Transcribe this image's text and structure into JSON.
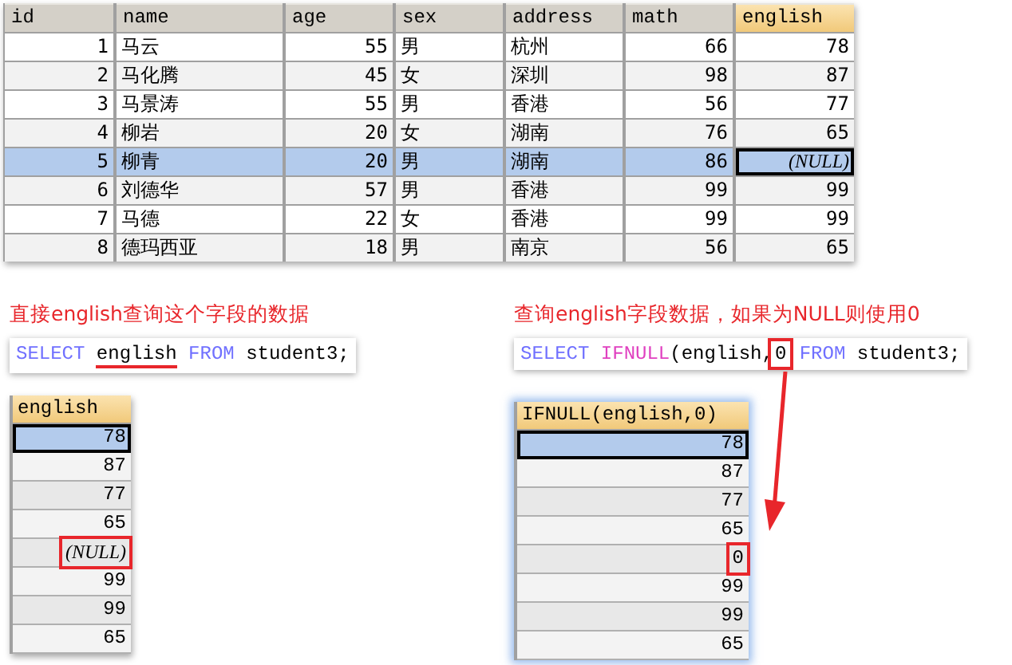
{
  "table": {
    "columns": [
      {
        "label": "id",
        "numeric": true,
        "selected": false
      },
      {
        "label": "name",
        "numeric": false,
        "selected": false
      },
      {
        "label": "age",
        "numeric": true,
        "selected": false
      },
      {
        "label": "sex",
        "numeric": false,
        "selected": false
      },
      {
        "label": "address",
        "numeric": false,
        "selected": false
      },
      {
        "label": "math",
        "numeric": true,
        "selected": false
      },
      {
        "label": "english",
        "numeric": true,
        "selected": true
      }
    ],
    "rows": [
      {
        "selected": false,
        "cells": [
          {
            "text": "1",
            "focused": false,
            "null": false
          },
          {
            "text": "马云",
            "focused": false,
            "null": false
          },
          {
            "text": "55",
            "focused": false,
            "null": false
          },
          {
            "text": "男",
            "focused": false,
            "null": false
          },
          {
            "text": "杭州",
            "focused": false,
            "null": false
          },
          {
            "text": "66",
            "focused": false,
            "null": false
          },
          {
            "text": "78",
            "focused": false,
            "null": false
          }
        ]
      },
      {
        "selected": false,
        "cells": [
          {
            "text": "2",
            "focused": false,
            "null": false
          },
          {
            "text": "马化腾",
            "focused": false,
            "null": false
          },
          {
            "text": "45",
            "focused": false,
            "null": false
          },
          {
            "text": "女",
            "focused": false,
            "null": false
          },
          {
            "text": "深圳",
            "focused": false,
            "null": false
          },
          {
            "text": "98",
            "focused": false,
            "null": false
          },
          {
            "text": "87",
            "focused": false,
            "null": false
          }
        ]
      },
      {
        "selected": false,
        "cells": [
          {
            "text": "3",
            "focused": false,
            "null": false
          },
          {
            "text": "马景涛",
            "focused": false,
            "null": false
          },
          {
            "text": "55",
            "focused": false,
            "null": false
          },
          {
            "text": "男",
            "focused": false,
            "null": false
          },
          {
            "text": "香港",
            "focused": false,
            "null": false
          },
          {
            "text": "56",
            "focused": false,
            "null": false
          },
          {
            "text": "77",
            "focused": false,
            "null": false
          }
        ]
      },
      {
        "selected": false,
        "cells": [
          {
            "text": "4",
            "focused": false,
            "null": false
          },
          {
            "text": "柳岩",
            "focused": false,
            "null": false
          },
          {
            "text": "20",
            "focused": false,
            "null": false
          },
          {
            "text": "女",
            "focused": false,
            "null": false
          },
          {
            "text": "湖南",
            "focused": false,
            "null": false
          },
          {
            "text": "76",
            "focused": false,
            "null": false
          },
          {
            "text": "65",
            "focused": false,
            "null": false
          }
        ]
      },
      {
        "selected": true,
        "cells": [
          {
            "text": "5",
            "focused": false,
            "null": false
          },
          {
            "text": "柳青",
            "focused": false,
            "null": false
          },
          {
            "text": "20",
            "focused": false,
            "null": false
          },
          {
            "text": "男",
            "focused": false,
            "null": false
          },
          {
            "text": "湖南",
            "focused": false,
            "null": false
          },
          {
            "text": "86",
            "focused": false,
            "null": false
          },
          {
            "text": "(NULL)",
            "focused": true,
            "null": true
          }
        ]
      },
      {
        "selected": false,
        "cells": [
          {
            "text": "6",
            "focused": false,
            "null": false
          },
          {
            "text": "刘德华",
            "focused": false,
            "null": false
          },
          {
            "text": "57",
            "focused": false,
            "null": false
          },
          {
            "text": "男",
            "focused": false,
            "null": false
          },
          {
            "text": "香港",
            "focused": false,
            "null": false
          },
          {
            "text": "99",
            "focused": false,
            "null": false
          },
          {
            "text": "99",
            "focused": false,
            "null": false
          }
        ]
      },
      {
        "selected": false,
        "cells": [
          {
            "text": "7",
            "focused": false,
            "null": false
          },
          {
            "text": "马德",
            "focused": false,
            "null": false
          },
          {
            "text": "22",
            "focused": false,
            "null": false
          },
          {
            "text": "女",
            "focused": false,
            "null": false
          },
          {
            "text": "香港",
            "focused": false,
            "null": false
          },
          {
            "text": "99",
            "focused": false,
            "null": false
          },
          {
            "text": "99",
            "focused": false,
            "null": false
          }
        ]
      },
      {
        "selected": false,
        "cells": [
          {
            "text": "8",
            "focused": false,
            "null": false
          },
          {
            "text": "德玛西亚",
            "focused": false,
            "null": false
          },
          {
            "text": "18",
            "focused": false,
            "null": false
          },
          {
            "text": "男",
            "focused": false,
            "null": false
          },
          {
            "text": "南京",
            "focused": false,
            "null": false
          },
          {
            "text": "56",
            "focused": false,
            "null": false
          },
          {
            "text": "65",
            "focused": false,
            "null": false
          }
        ]
      }
    ]
  },
  "examples": [
    {
      "caption": "直接english查询这个字段的数据",
      "tokens": [
        {
          "text": "SELECT ",
          "kind": "keyword"
        },
        {
          "text": "english",
          "kind": "underlined"
        },
        {
          "text": " FROM ",
          "kind": "keyword"
        },
        {
          "text": "student3;",
          "kind": "plain"
        }
      ],
      "result": {
        "header": "english",
        "rows": [
          {
            "text": "78",
            "selected": true,
            "highlighted": false,
            "null": false
          },
          {
            "text": "87",
            "selected": false,
            "highlighted": false,
            "null": false
          },
          {
            "text": "77",
            "selected": false,
            "highlighted": false,
            "null": false
          },
          {
            "text": "65",
            "selected": false,
            "highlighted": false,
            "null": false
          },
          {
            "text": "(NULL)",
            "selected": false,
            "highlighted": true,
            "null": true
          },
          {
            "text": "99",
            "selected": false,
            "highlighted": false,
            "null": false
          },
          {
            "text": "99",
            "selected": false,
            "highlighted": false,
            "null": false
          },
          {
            "text": "65",
            "selected": false,
            "highlighted": false,
            "null": false
          }
        ]
      }
    },
    {
      "caption": "查询english字段数据，如果为NULL则使用0",
      "tokens": [
        {
          "text": "SELECT ",
          "kind": "keyword"
        },
        {
          "text": "IFNULL",
          "kind": "function"
        },
        {
          "text": "(english,",
          "kind": "plain"
        },
        {
          "text": "0",
          "kind": "boxed"
        },
        {
          "text": " FROM ",
          "kind": "keyword"
        },
        {
          "text": "student3;",
          "kind": "plain"
        }
      ],
      "result": {
        "header": "IFNULL(english,0)",
        "rows": [
          {
            "text": "78",
            "selected": true,
            "highlighted": false,
            "null": false
          },
          {
            "text": "87",
            "selected": false,
            "highlighted": false,
            "null": false
          },
          {
            "text": "77",
            "selected": false,
            "highlighted": false,
            "null": false
          },
          {
            "text": "65",
            "selected": false,
            "highlighted": false,
            "null": false
          },
          {
            "text": "0",
            "selected": false,
            "highlighted": true,
            "null": false
          },
          {
            "text": "99",
            "selected": false,
            "highlighted": false,
            "null": false
          },
          {
            "text": "99",
            "selected": false,
            "highlighted": false,
            "null": false
          },
          {
            "text": "65",
            "selected": false,
            "highlighted": false,
            "null": false
          }
        ]
      }
    }
  ]
}
